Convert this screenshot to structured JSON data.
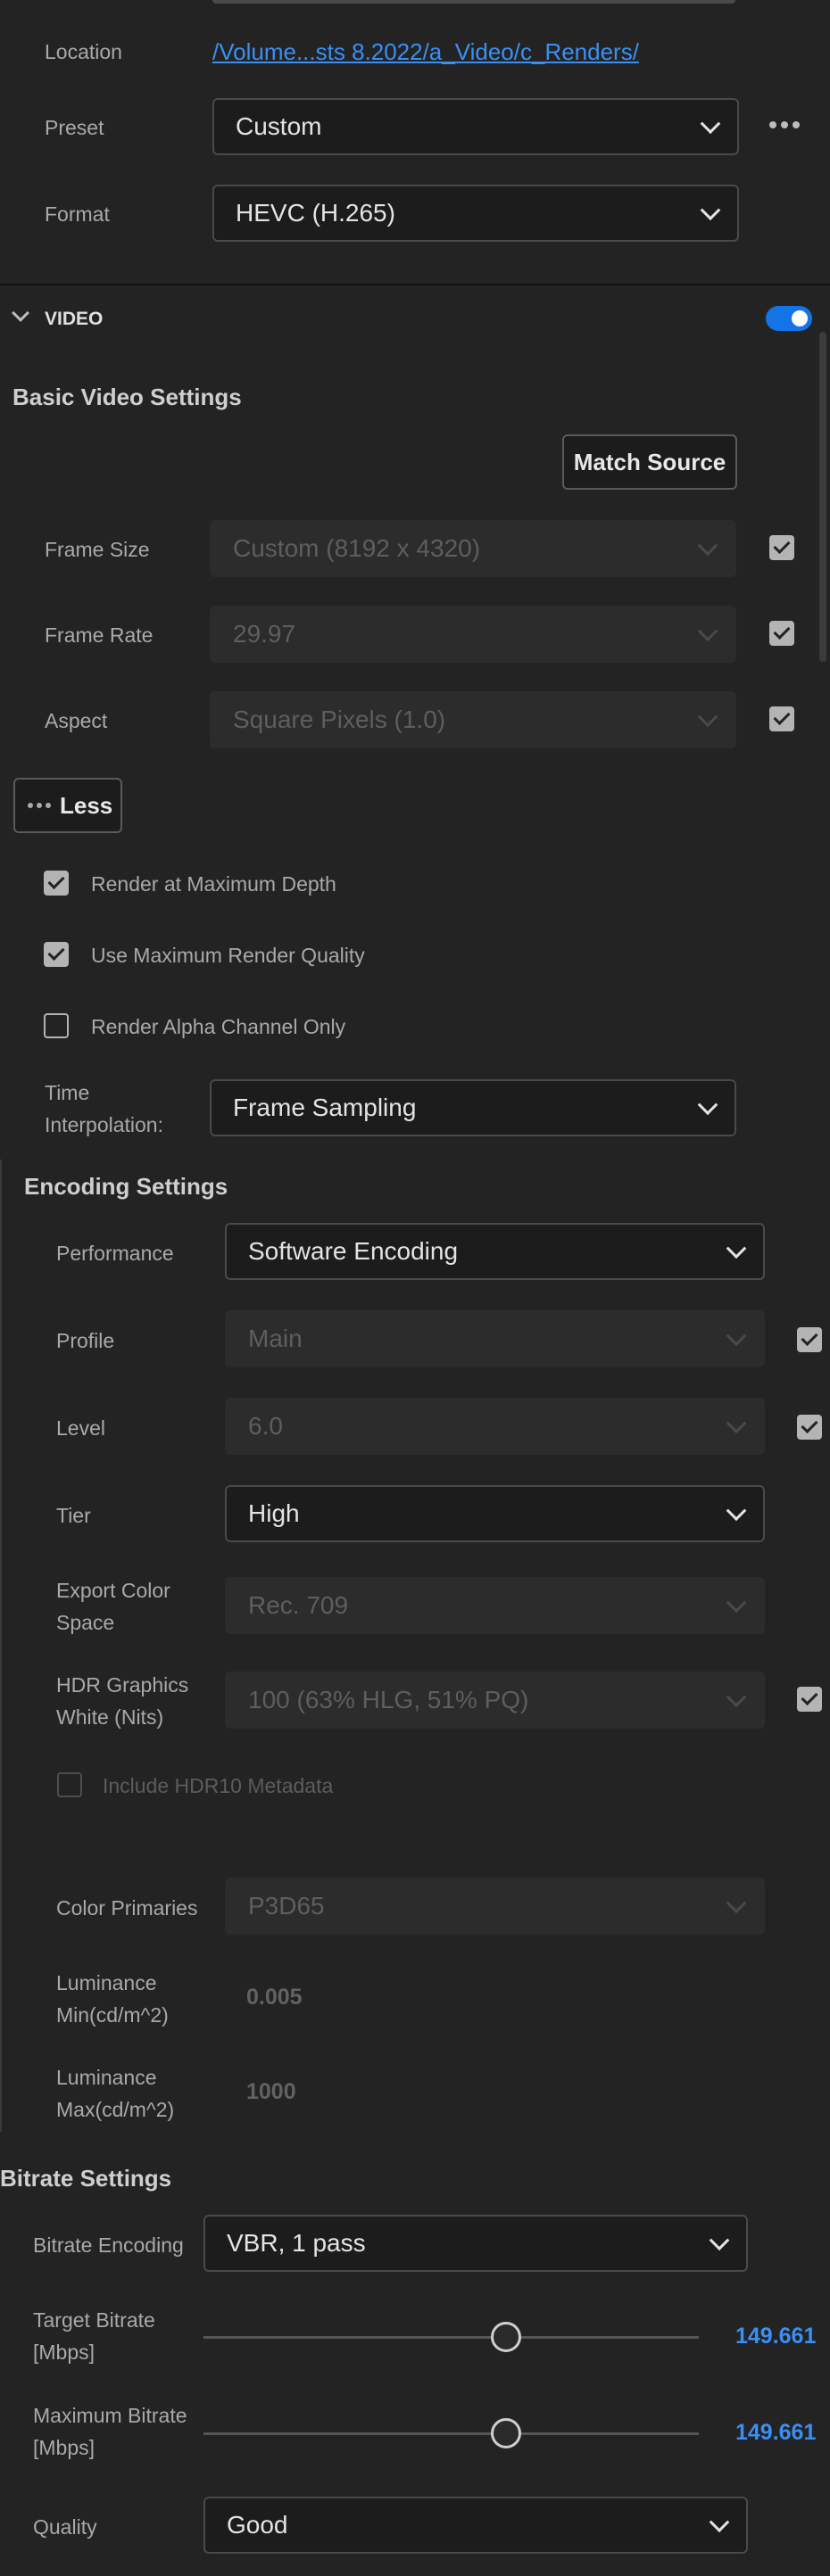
{
  "output": {
    "location_label": "Location",
    "location_value": "/Volume...sts 8.2022/a_Video/c_Renders/",
    "preset_label": "Preset",
    "preset_value": "Custom",
    "format_label": "Format",
    "format_value": "HEVC (H.265)"
  },
  "video": {
    "section_title": "VIDEO",
    "toggle_on": true,
    "basic_title": "Basic Video Settings",
    "match_source": "Match Source",
    "frame_size_label": "Frame Size",
    "frame_size_value": "Custom (8192 x 4320)",
    "frame_rate_label": "Frame Rate",
    "frame_rate_value": "29.97",
    "aspect_label": "Aspect",
    "aspect_value": "Square Pixels (1.0)",
    "less_button": "Less",
    "render_max_depth": "Render at Maximum Depth",
    "use_max_quality": "Use Maximum Render Quality",
    "render_alpha": "Render Alpha Channel Only",
    "time_interp_label_1": "Time",
    "time_interp_label_2": "Interpolation:",
    "time_interp_value": "Frame Sampling"
  },
  "encoding": {
    "title": "Encoding Settings",
    "performance_label": "Performance",
    "performance_value": "Software Encoding",
    "profile_label": "Profile",
    "profile_value": "Main",
    "level_label": "Level",
    "level_value": "6.0",
    "tier_label": "Tier",
    "tier_value": "High",
    "export_color_label_1": "Export Color",
    "export_color_label_2": "Space",
    "export_color_value": "Rec. 709",
    "hdr_label_1": "HDR Graphics",
    "hdr_label_2": "White (Nits)",
    "hdr_value": "100 (63% HLG, 51% PQ)",
    "include_hdr10": "Include HDR10 Metadata",
    "color_primaries_label": "Color Primaries",
    "color_primaries_value": "P3D65",
    "lum_min_label_1": "Luminance",
    "lum_min_label_2": "Min(cd/m^2)",
    "lum_min_value": "0.005",
    "lum_max_label_1": "Luminance",
    "lum_max_label_2": "Max(cd/m^2)",
    "lum_max_value": "1000"
  },
  "bitrate": {
    "title": "Bitrate Settings",
    "encoding_label": "Bitrate Encoding",
    "encoding_value": "VBR, 1 pass",
    "target_label_1": "Target Bitrate",
    "target_label_2": "[Mbps]",
    "target_value": "149.661",
    "target_fraction": 0.61,
    "max_label_1": "Maximum Bitrate",
    "max_label_2": "[Mbps]",
    "max_value": "149.661",
    "max_fraction": 0.61,
    "quality_label": "Quality",
    "quality_value": "Good"
  },
  "colors": {
    "accent": "#1473e6",
    "link": "#3a8ff5",
    "background": "#232323"
  }
}
